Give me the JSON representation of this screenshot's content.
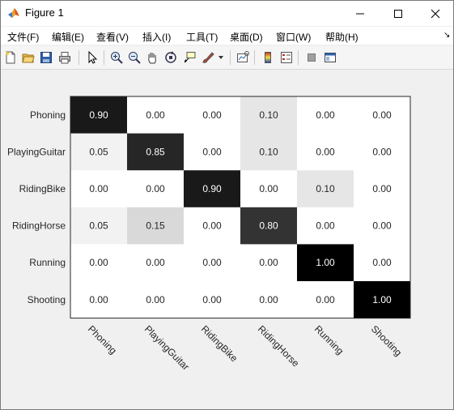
{
  "window": {
    "title": "Figure 1"
  },
  "menu": {
    "items": [
      "文件(F)",
      "编辑(E)",
      "查看(V)",
      "插入(I)",
      "工具(T)",
      "桌面(D)",
      "窗口(W)",
      "帮助(H)"
    ]
  },
  "toolbar": {
    "icons": [
      "new-figure-icon",
      "open-file-icon",
      "save-icon",
      "print-icon",
      "select-pointer-icon",
      "zoom-in-icon",
      "zoom-out-icon",
      "pan-hand-icon",
      "rotate-3d-icon",
      "data-cursor-icon",
      "brush-icon",
      "link-plot-icon",
      "colorbar-icon",
      "legend-icon",
      "hide-plot-tools-icon",
      "show-plot-tools-icon"
    ]
  },
  "chart_data": {
    "type": "heatmap",
    "rows": [
      "Phoning",
      "PlayingGuitar",
      "RidingBike",
      "RidingHorse",
      "Running",
      "Shooting"
    ],
    "columns": [
      "Phoning",
      "PlayingGuitar",
      "RidingBike",
      "RidingHorse",
      "Running",
      "Shooting"
    ],
    "values": [
      [
        0.9,
        0.0,
        0.0,
        0.1,
        0.0,
        0.0
      ],
      [
        0.05,
        0.85,
        0.0,
        0.1,
        0.0,
        0.0
      ],
      [
        0.0,
        0.0,
        0.9,
        0.0,
        0.1,
        0.0
      ],
      [
        0.05,
        0.15,
        0.0,
        0.8,
        0.0,
        0.0
      ],
      [
        0.0,
        0.0,
        0.0,
        0.0,
        1.0,
        0.0
      ],
      [
        0.0,
        0.0,
        0.0,
        0.0,
        0.0,
        1.0
      ]
    ],
    "colormap": "white-to-black",
    "value_format": "0.00"
  }
}
